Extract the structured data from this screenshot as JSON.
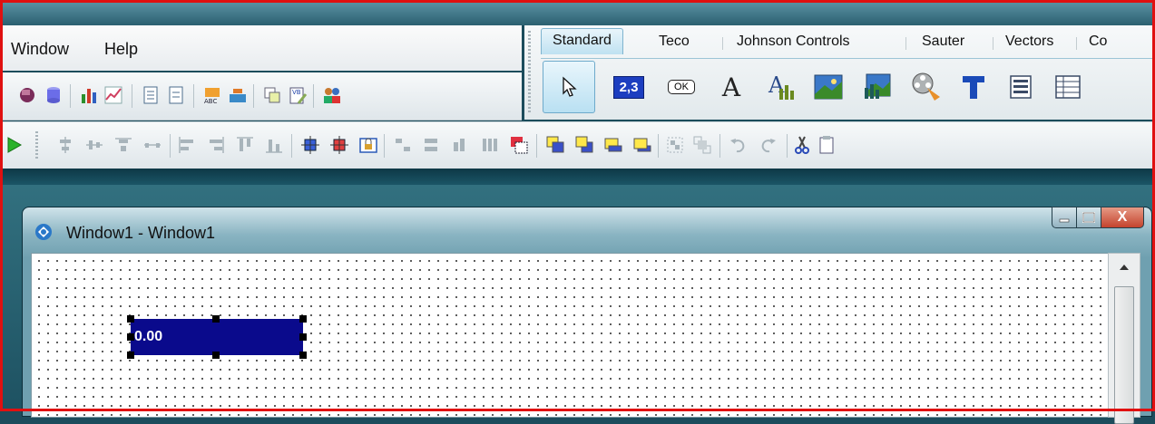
{
  "menu": {
    "window": "Window",
    "help": "Help"
  },
  "palette": {
    "tabs": [
      "Standard",
      "Teco",
      "Johnson Controls",
      "Sauter",
      "Vectors",
      "Co"
    ],
    "active_tab": "Standard",
    "numeric_icon_label": "2,3",
    "button_icon_label": "OK",
    "label_icon_text": "A",
    "icons": [
      "pointer-icon",
      "numeric-field-icon",
      "button-icon",
      "label-icon",
      "chart-text-icon",
      "image-icon",
      "image-gauge-icon",
      "video-icon",
      "text-icon",
      "listbox-icon",
      "grid-icon"
    ]
  },
  "toolbar1": {
    "icons": [
      "edit-icon",
      "db-icon",
      "bar-chart-icon",
      "line-chart-icon",
      "page-icon",
      "page-icon-2",
      "abc-icon",
      "transfer-icon",
      "copy-icon",
      "vb-script-icon",
      "users-icon"
    ]
  },
  "toolbar2": {
    "icons": [
      "play-icon",
      "align-center-h-icon",
      "align-middle-icon",
      "align-top-icon",
      "align-bottom-icon",
      "align-left-icon",
      "align-right-icon",
      "send-top-icon",
      "send-bottom-icon",
      "center-icon",
      "center-red-icon",
      "lock-icon",
      "space-h-icon",
      "space-v-icon",
      "resize-icon",
      "resize2-icon",
      "move-icon",
      "bring-front-icon",
      "bring-forward-icon",
      "send-back-icon",
      "send-backward-icon",
      "group-icon",
      "ungroup-icon",
      "undo-icon",
      "redo-icon",
      "cut-icon",
      "paste-icon"
    ]
  },
  "window": {
    "title": "Window1 - Window1",
    "close_glyph": "X"
  },
  "canvas": {
    "numeric_value": "0.00"
  },
  "colors": {
    "frame": "#e01010",
    "selection": "#0a0a8c"
  }
}
